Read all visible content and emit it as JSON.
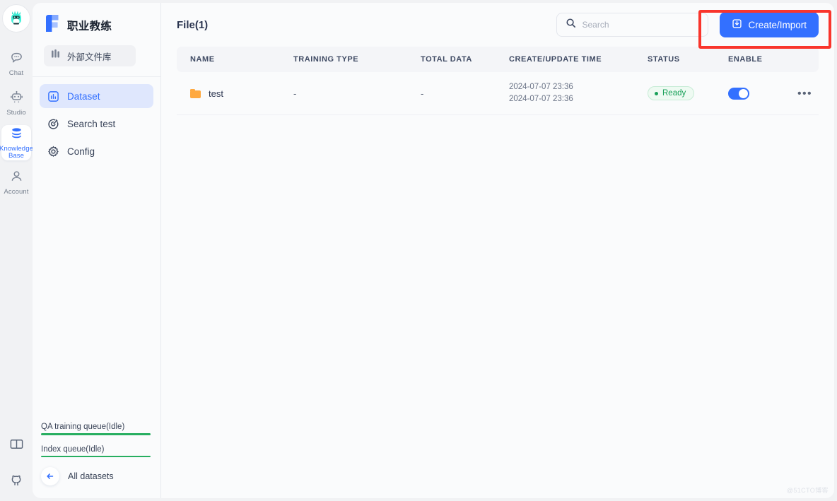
{
  "rail": {
    "avatar_name": "user-avatar",
    "items": [
      {
        "label": "Chat",
        "icon": "chat-icon",
        "active": false
      },
      {
        "label": "Studio",
        "icon": "robot-icon",
        "active": false
      },
      {
        "label": "Knowledge Base",
        "icon": "database-icon",
        "active": true
      },
      {
        "label": "Account",
        "icon": "person-icon",
        "active": false
      }
    ],
    "bottom": [
      {
        "icon": "book-icon"
      },
      {
        "icon": "github-icon"
      }
    ]
  },
  "sidebar": {
    "brand": "职业教练",
    "external_library": "外部文件库",
    "nav": [
      {
        "label": "Dataset",
        "icon": "bar-chart-icon",
        "active": true
      },
      {
        "label": "Search test",
        "icon": "target-icon",
        "active": false
      },
      {
        "label": "Config",
        "icon": "gear-icon",
        "active": false
      }
    ],
    "queues": [
      {
        "label": "QA training queue(Idle)",
        "color": "#27ae60"
      },
      {
        "label": "Index queue(Idle)",
        "color": "#27ae60"
      }
    ],
    "all_datasets": "All datasets"
  },
  "main": {
    "title": "File(1)",
    "search_placeholder": "Search",
    "search_value": "",
    "create_button": "Create/Import",
    "table": {
      "columns": [
        "NAME",
        "TRAINING TYPE",
        "TOTAL DATA",
        "CREATE/UPDATE TIME",
        "STATUS",
        "ENABLE",
        ""
      ],
      "rows": [
        {
          "name": "test",
          "training_type": "-",
          "total_data": "-",
          "create_time": "2024-07-07 23:36",
          "update_time": "2024-07-07 23:36",
          "status": "Ready",
          "enabled": true,
          "more": "•••"
        }
      ]
    }
  },
  "annotation": {
    "color": "#f9352c"
  },
  "watermark": "@51CTO博客"
}
